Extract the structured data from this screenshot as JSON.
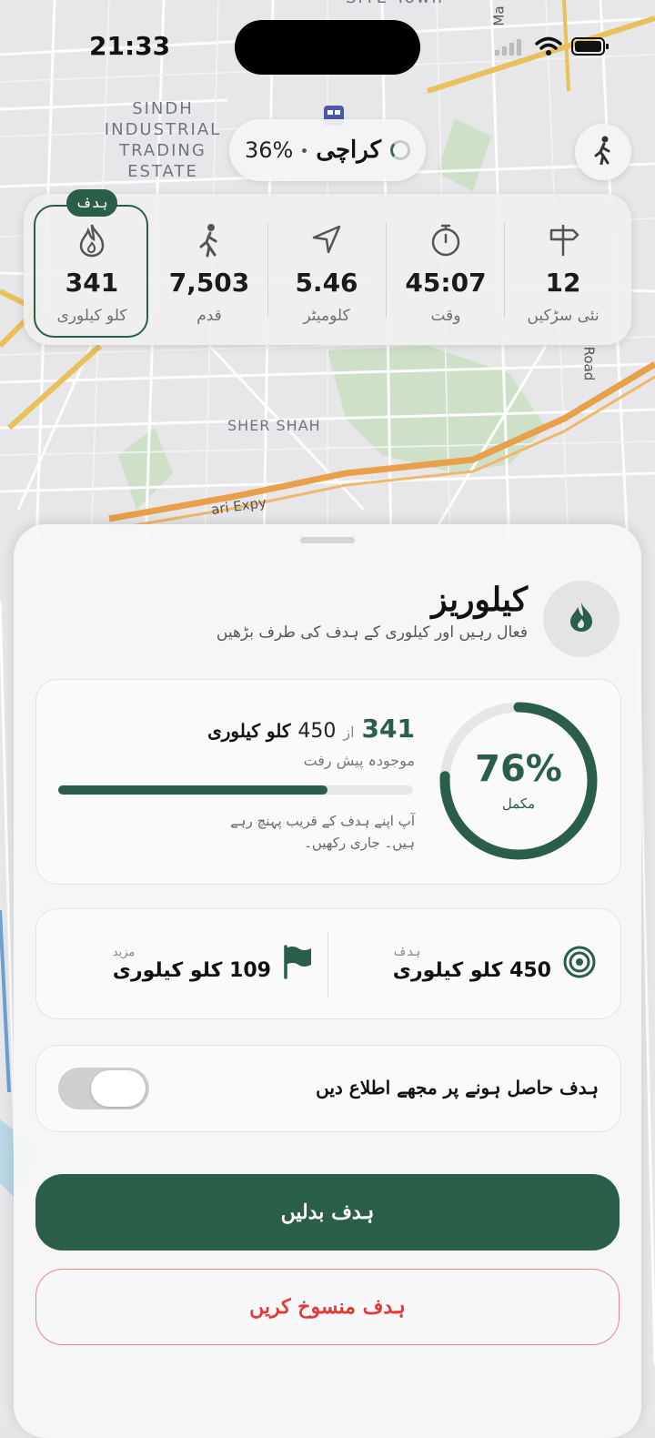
{
  "status_bar": {
    "time": "21:33"
  },
  "map": {
    "labels": {
      "top_partial": "SITE Town",
      "right_partial": "Ma",
      "district": [
        "SINDH",
        "INDUSTRIAL",
        "TRADING",
        "ESTATE"
      ],
      "area": "SHER SHAH",
      "expressway": "ari Expy",
      "road_right": "Road"
    }
  },
  "location_pill": {
    "percent": "36%",
    "city": "کراچی"
  },
  "stats": {
    "goal_tag": "ہدف",
    "items": [
      {
        "icon": "flame-icon",
        "value": "341",
        "label": "کلو کیلوری"
      },
      {
        "icon": "walking-person-icon",
        "value": "7,503",
        "label": "قدم"
      },
      {
        "icon": "navigation-arrow-icon",
        "value": "5.46",
        "label": "کلومیٹر"
      },
      {
        "icon": "stopwatch-icon",
        "value": "45:07",
        "label": "وقت"
      },
      {
        "icon": "signpost-icon",
        "value": "12",
        "label": "نئی سڑکیں"
      }
    ]
  },
  "sheet": {
    "title": "کیلوریز",
    "subtitle": "فعال رہیں اور کیلوری کے ہدف کی طرف بڑھیں",
    "progress": {
      "percent_text": "76%",
      "percent_value": 0.76,
      "ring_sub": "مکمل",
      "current": "341",
      "of_word": "از",
      "goal": "450",
      "unit": "کلو کیلوری",
      "current_label": "موجودہ پیش رفت",
      "bar_fraction": 0.76,
      "encouragement": "آپ اپنے ہدف کے قریب پہنچ رہے ہیں۔ جاری رکھیں۔"
    },
    "targets": {
      "goal_small": "ہدف",
      "goal_value": "450 کلو کیلوری",
      "remaining_small": "مزید",
      "remaining_value": "109 کلو کیلوری"
    },
    "notify": {
      "label": "ہدف حاصل ہونے پر مجھے اطلاع دیں",
      "enabled": false
    },
    "buttons": {
      "change_goal": "ہدف بدلیں",
      "cancel_goal": "ہدف منسوخ کریں"
    }
  },
  "colors": {
    "accent": "#2b5e48",
    "danger": "#e03b3b",
    "map_bg": "#e6e6e8"
  }
}
